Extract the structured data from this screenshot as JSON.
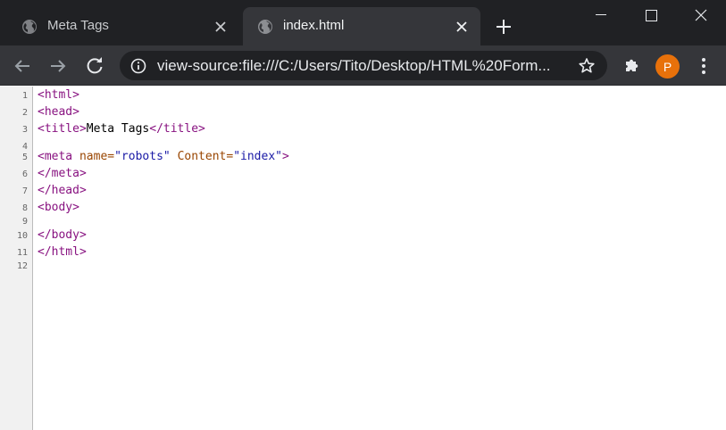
{
  "tabs": [
    {
      "title": "Meta Tags",
      "active": false
    },
    {
      "title": "index.html",
      "active": true
    }
  ],
  "toolbar": {
    "url": "view-source:file:///C:/Users/Tito/Desktop/HTML%20Form...",
    "avatar_letter": "P"
  },
  "colors": {
    "tabstrip": "#202124",
    "toolbar": "#35363a",
    "avatar": "#e8710a",
    "tag": "#881280",
    "attribute": "#994500",
    "value": "#1a1aa6"
  },
  "icons": [
    "globe-icon",
    "close-icon",
    "plus-icon",
    "minimize-icon",
    "maximize-icon",
    "back-icon",
    "forward-icon",
    "reload-icon",
    "info-icon",
    "star-icon",
    "puzzle-icon",
    "more-vert-icon"
  ],
  "source": {
    "lines": [
      {
        "n": "1",
        "tokens": [
          {
            "t": "tag",
            "v": "<html>"
          }
        ]
      },
      {
        "n": "2",
        "tokens": [
          {
            "t": "tag",
            "v": "<head>"
          }
        ]
      },
      {
        "n": "3",
        "tokens": [
          {
            "t": "tag",
            "v": "<title>"
          },
          {
            "t": "txt",
            "v": "Meta Tags"
          },
          {
            "t": "tag",
            "v": "</title>"
          }
        ]
      },
      {
        "n": "4",
        "tokens": []
      },
      {
        "n": "5",
        "tokens": [
          {
            "t": "tag",
            "v": "<meta "
          },
          {
            "t": "attr",
            "v": "name="
          },
          {
            "t": "val",
            "v": "\"robots\""
          },
          {
            "t": "txt",
            "v": " "
          },
          {
            "t": "attr",
            "v": "Content="
          },
          {
            "t": "val",
            "v": "\"index\""
          },
          {
            "t": "tag",
            "v": ">"
          }
        ]
      },
      {
        "n": "6",
        "tokens": [
          {
            "t": "tag",
            "v": "</meta>"
          }
        ]
      },
      {
        "n": "7",
        "tokens": [
          {
            "t": "tag",
            "v": "</head>"
          }
        ]
      },
      {
        "n": "8",
        "tokens": [
          {
            "t": "tag",
            "v": "<body>"
          }
        ]
      },
      {
        "n": "9",
        "tokens": []
      },
      {
        "n": "10",
        "tokens": [
          {
            "t": "tag",
            "v": "</body>"
          }
        ]
      },
      {
        "n": "11",
        "tokens": [
          {
            "t": "tag",
            "v": "</html>"
          }
        ]
      },
      {
        "n": "12",
        "tokens": []
      }
    ]
  }
}
